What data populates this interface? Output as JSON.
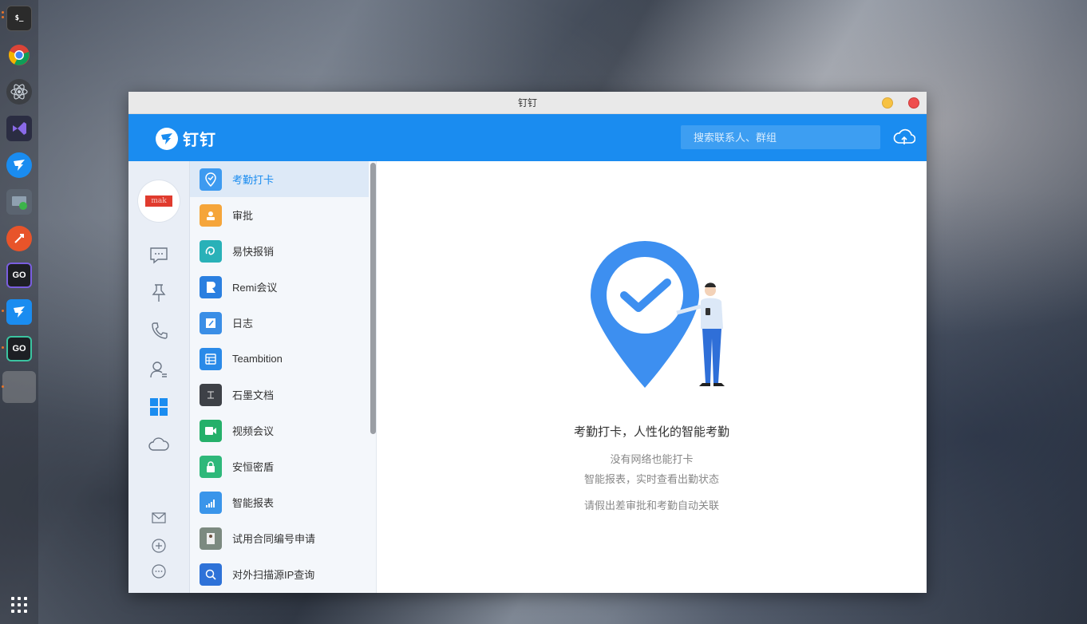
{
  "window": {
    "title": "钉钉"
  },
  "header": {
    "logo_text": "钉钉",
    "search_placeholder": "搜索联系人、群组"
  },
  "avatar": {
    "tag_text": "mak"
  },
  "nav": {
    "icons": [
      "chat-icon",
      "pin-icon",
      "phone-icon",
      "contacts-icon",
      "workbench-icon",
      "cloud-icon",
      "mail-icon",
      "add-icon",
      "more-icon"
    ]
  },
  "apps": [
    {
      "label": "考勤打卡",
      "icon": "location-check-icon",
      "color": "#3d9af0"
    },
    {
      "label": "审批",
      "icon": "approval-icon",
      "color": "#f5a53a"
    },
    {
      "label": "易快报销",
      "icon": "reimburse-icon",
      "color": "#29b1b8"
    },
    {
      "label": "Remi会议",
      "icon": "remi-icon",
      "color": "#2a7fe0"
    },
    {
      "label": "日志",
      "icon": "log-icon",
      "color": "#3a8ee6"
    },
    {
      "label": "Teambition",
      "icon": "teambition-icon",
      "color": "#2a8ae8"
    },
    {
      "label": "石墨文档",
      "icon": "shimo-icon",
      "color": "#3e4147"
    },
    {
      "label": "视频会议",
      "icon": "video-call-icon",
      "color": "#25b06a"
    },
    {
      "label": "安恒密盾",
      "icon": "lock-icon",
      "color": "#2eb87a"
    },
    {
      "label": "智能报表",
      "icon": "report-icon",
      "color": "#3a95ea"
    },
    {
      "label": "试用合同编号申请",
      "icon": "contract-icon",
      "color": "#7c8a80"
    },
    {
      "label": "对外扫描源IP查询",
      "icon": "scan-icon",
      "color": "#2e72d8"
    }
  ],
  "main": {
    "title": "考勤打卡，人性化的智能考勤",
    "line1": "没有网络也能打卡",
    "line2": "智能报表，实时查看出勤状态",
    "line3": "请假出差审批和考勤自动关联"
  },
  "colors": {
    "brand": "#1a8cf0",
    "active_bg": "#dde9f7"
  }
}
